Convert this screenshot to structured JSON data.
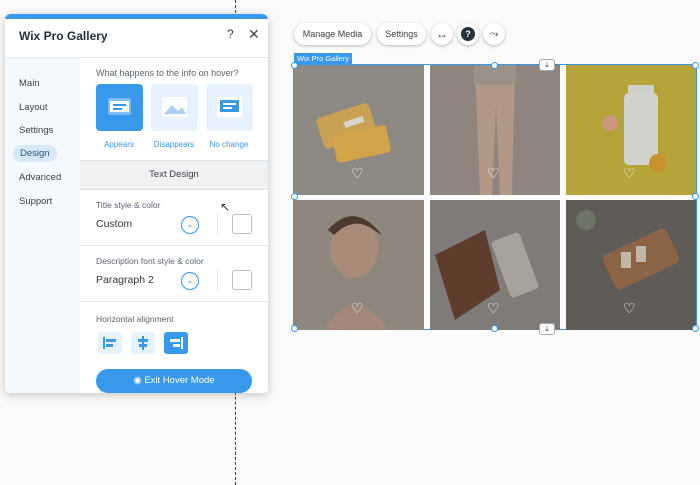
{
  "panel": {
    "title": "Wix Pro Gallery",
    "help": "?",
    "close": "✕",
    "sidebar": [
      "Main",
      "Layout",
      "Settings",
      "Design",
      "Advanced",
      "Support"
    ],
    "active_item": "Design",
    "hover_question": "What happens to the info on hover?",
    "hover_options": [
      "Appears",
      "Disappears",
      "No change"
    ],
    "selected_hover_option": "Appears",
    "section_band": "Text Design",
    "title_style_label": "Title style & color",
    "title_style_value": "Custom",
    "desc_style_label": "Description font style & color",
    "desc_style_value": "Paragraph 2",
    "alignment_label": "Horizontal alignment",
    "exit_button": "Exit Hover Mode"
  },
  "toolbar": {
    "manage_media": "Manage Media",
    "settings": "Settings",
    "stretch_icon": "↔",
    "help_icon": "?",
    "animate_icon": "⤳"
  },
  "gallery": {
    "tag": "Wix Pro Gallery",
    "tiles": [
      "soap-bars",
      "legs",
      "bottle-yellow",
      "smiling-woman",
      "serum-bottle",
      "wooden-tray"
    ],
    "heart": "♡",
    "download": "⤓"
  },
  "colors": {
    "accent": "#3899ec"
  }
}
